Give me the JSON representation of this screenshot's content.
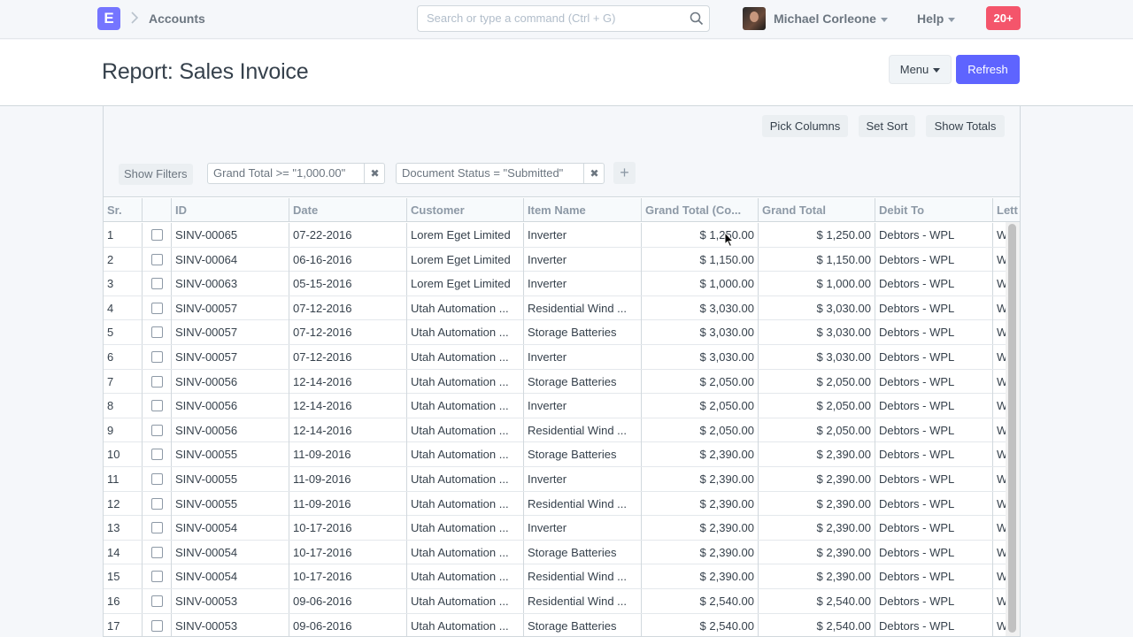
{
  "nav": {
    "logo": "E",
    "breadcrumb": "Accounts",
    "search_placeholder": "Search or type a command (Ctrl + G)",
    "user": "Michael Corleone",
    "help": "Help",
    "notifications": "20+"
  },
  "page": {
    "title": "Report: Sales Invoice",
    "menu_label": "Menu",
    "refresh_label": "Refresh"
  },
  "toolbar": {
    "pick_columns": "Pick Columns",
    "set_sort": "Set Sort",
    "show_totals": "Show Totals"
  },
  "filters": {
    "show_filters": "Show Filters",
    "chips": [
      {
        "label": "Grand Total >= \"1,000.00\"",
        "remove": "✖"
      },
      {
        "label": "Document Status = \"Submitted\"",
        "remove": "✖"
      }
    ],
    "add": "+"
  },
  "grid": {
    "columns": [
      "Sr.",
      "",
      "ID",
      "Date",
      "Customer",
      "Item Name",
      "Grand Total (Co...",
      "Grand Total",
      "Debit To",
      "Lett"
    ],
    "rows": [
      [
        "1",
        "SINV-00065",
        "07-22-2016",
        "Lorem Eget Limited",
        "Inverter",
        "$ 1,250.00",
        "$ 1,250.00",
        "Debtors - WPL",
        "W"
      ],
      [
        "2",
        "SINV-00064",
        "06-16-2016",
        "Lorem Eget Limited",
        "Inverter",
        "$ 1,150.00",
        "$ 1,150.00",
        "Debtors - WPL",
        "W"
      ],
      [
        "3",
        "SINV-00063",
        "05-15-2016",
        "Lorem Eget Limited",
        "Inverter",
        "$ 1,000.00",
        "$ 1,000.00",
        "Debtors - WPL",
        "W"
      ],
      [
        "4",
        "SINV-00057",
        "07-12-2016",
        "Utah Automation ...",
        "Residential Wind ...",
        "$ 3,030.00",
        "$ 3,030.00",
        "Debtors - WPL",
        "W"
      ],
      [
        "5",
        "SINV-00057",
        "07-12-2016",
        "Utah Automation ...",
        "Storage Batteries",
        "$ 3,030.00",
        "$ 3,030.00",
        "Debtors - WPL",
        "W"
      ],
      [
        "6",
        "SINV-00057",
        "07-12-2016",
        "Utah Automation ...",
        "Inverter",
        "$ 3,030.00",
        "$ 3,030.00",
        "Debtors - WPL",
        "W"
      ],
      [
        "7",
        "SINV-00056",
        "12-14-2016",
        "Utah Automation ...",
        "Storage Batteries",
        "$ 2,050.00",
        "$ 2,050.00",
        "Debtors - WPL",
        "W"
      ],
      [
        "8",
        "SINV-00056",
        "12-14-2016",
        "Utah Automation ...",
        "Inverter",
        "$ 2,050.00",
        "$ 2,050.00",
        "Debtors - WPL",
        "W"
      ],
      [
        "9",
        "SINV-00056",
        "12-14-2016",
        "Utah Automation ...",
        "Residential Wind ...",
        "$ 2,050.00",
        "$ 2,050.00",
        "Debtors - WPL",
        "W"
      ],
      [
        "10",
        "SINV-00055",
        "11-09-2016",
        "Utah Automation ...",
        "Storage Batteries",
        "$ 2,390.00",
        "$ 2,390.00",
        "Debtors - WPL",
        "W"
      ],
      [
        "11",
        "SINV-00055",
        "11-09-2016",
        "Utah Automation ...",
        "Inverter",
        "$ 2,390.00",
        "$ 2,390.00",
        "Debtors - WPL",
        "W"
      ],
      [
        "12",
        "SINV-00055",
        "11-09-2016",
        "Utah Automation ...",
        "Residential Wind ...",
        "$ 2,390.00",
        "$ 2,390.00",
        "Debtors - WPL",
        "W"
      ],
      [
        "13",
        "SINV-00054",
        "10-17-2016",
        "Utah Automation ...",
        "Inverter",
        "$ 2,390.00",
        "$ 2,390.00",
        "Debtors - WPL",
        "W"
      ],
      [
        "14",
        "SINV-00054",
        "10-17-2016",
        "Utah Automation ...",
        "Storage Batteries",
        "$ 2,390.00",
        "$ 2,390.00",
        "Debtors - WPL",
        "W"
      ],
      [
        "15",
        "SINV-00054",
        "10-17-2016",
        "Utah Automation ...",
        "Residential Wind ...",
        "$ 2,390.00",
        "$ 2,390.00",
        "Debtors - WPL",
        "W"
      ],
      [
        "16",
        "SINV-00053",
        "09-06-2016",
        "Utah Automation ...",
        "Residential Wind ...",
        "$ 2,540.00",
        "$ 2,540.00",
        "Debtors - WPL",
        "W"
      ],
      [
        "17",
        "SINV-00053",
        "09-06-2016",
        "Utah Automation ...",
        "Storage Batteries",
        "$ 2,540.00",
        "$ 2,540.00",
        "Debtors - WPL",
        "W"
      ]
    ]
  },
  "colors": {
    "primary": "#5e64ff",
    "logo": "#7575ff",
    "notification": "#f4556b"
  }
}
